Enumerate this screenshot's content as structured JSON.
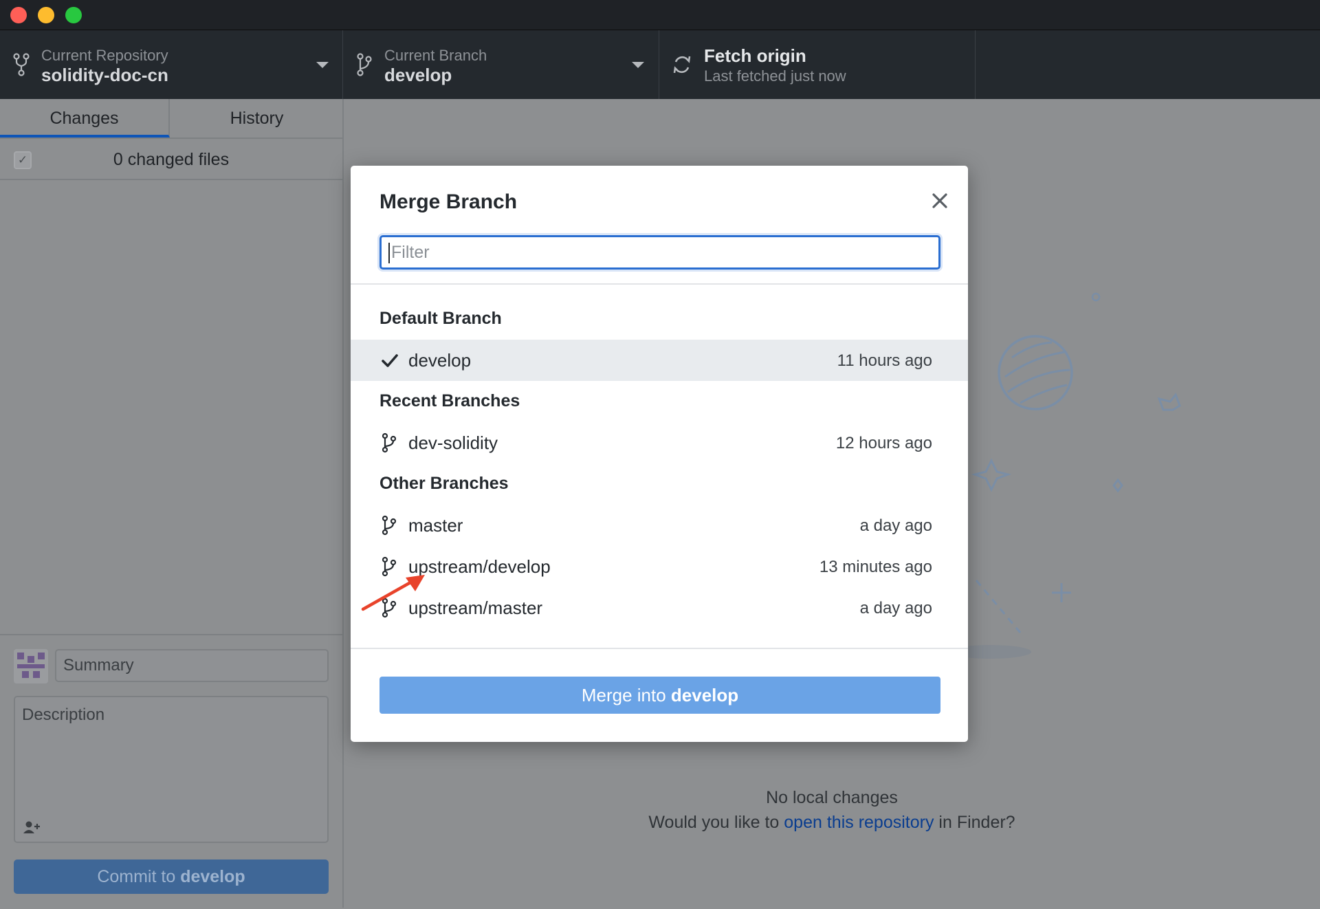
{
  "toolbar": {
    "repository": {
      "label": "Current Repository",
      "value": "solidity-doc-cn",
      "icon": "repo-icon"
    },
    "branch": {
      "label": "Current Branch",
      "value": "develop",
      "icon": "git-branch-icon"
    },
    "fetch": {
      "label": "Fetch origin",
      "status": "Last fetched just now",
      "icon": "sync-icon"
    }
  },
  "sidebar": {
    "tabs": [
      {
        "label": "Changes"
      },
      {
        "label": "History"
      }
    ],
    "changed_files_text": "0 changed files",
    "commit": {
      "summary_placeholder": "Summary",
      "description_placeholder": "Description",
      "button_prefix": "Commit to ",
      "button_branch": "develop"
    }
  },
  "main": {
    "no_changes_title": "No local changes",
    "finder_prefix": "Would you like to ",
    "finder_link": "open this repository",
    "finder_suffix": " in Finder?"
  },
  "modal": {
    "title": "Merge Branch",
    "filter_placeholder": "Filter",
    "sections": {
      "default": {
        "heading": "Default Branch",
        "branches": [
          {
            "name": "develop",
            "time": "11 hours ago",
            "selected": true
          }
        ]
      },
      "recent": {
        "heading": "Recent Branches",
        "branches": [
          {
            "name": "dev-solidity",
            "time": "12 hours ago"
          }
        ]
      },
      "other": {
        "heading": "Other Branches",
        "branches": [
          {
            "name": "master",
            "time": "a day ago"
          },
          {
            "name": "upstream/develop",
            "time": "13 minutes ago"
          },
          {
            "name": "upstream/master",
            "time": "a day ago"
          }
        ]
      }
    },
    "merge_button_prefix": "Merge into ",
    "merge_button_branch": "develop"
  },
  "colors": {
    "accent": "#2a6ed1",
    "merge_button": "#6aa3e6",
    "toolbar_bg": "#24292e",
    "annotation_arrow": "#e8432b"
  }
}
